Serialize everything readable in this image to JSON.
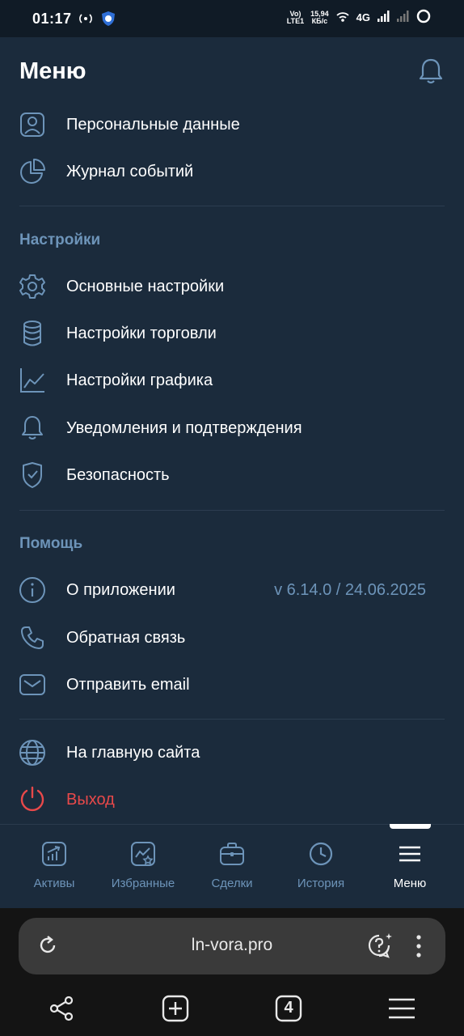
{
  "status_bar": {
    "time": "01:17",
    "volte_line1": "Vo)",
    "volte_line2": "LTE1",
    "speed_line1": "15,94",
    "speed_line2": "КБ/с",
    "network": "4G"
  },
  "header": {
    "title": "Меню",
    "bell_icon": "bell-icon"
  },
  "account": {
    "items": [
      {
        "label": "Персональные данные",
        "icon": "user-portrait-icon"
      },
      {
        "label": "Журнал событий",
        "icon": "pie-chart-icon"
      }
    ]
  },
  "settings": {
    "title": "Настройки",
    "items": [
      {
        "label": "Основные настройки",
        "icon": "gear-icon"
      },
      {
        "label": "Настройки торговли",
        "icon": "coin-stack-icon"
      },
      {
        "label": "Настройки графика",
        "icon": "line-chart-icon"
      },
      {
        "label": "Уведомления и подтверждения",
        "icon": "bell-icon"
      },
      {
        "label": "Безопасность",
        "icon": "shield-check-icon"
      }
    ]
  },
  "help": {
    "title": "Помощь",
    "items": [
      {
        "label": "О приложении",
        "value": "v 6.14.0 / 24.06.2025",
        "icon": "info-icon"
      },
      {
        "label": "Обратная связь",
        "icon": "phone-icon"
      },
      {
        "label": "Отправить email",
        "icon": "mail-icon"
      }
    ]
  },
  "misc": {
    "items": [
      {
        "label": "На главную сайта",
        "icon": "globe-icon"
      },
      {
        "label": "Выход",
        "icon": "power-icon"
      }
    ]
  },
  "tabbar": {
    "active": "Меню",
    "tabs": [
      {
        "label": "Активы",
        "icon": "assets-chart-icon"
      },
      {
        "label": "Избранные",
        "icon": "favorites-chart-icon"
      },
      {
        "label": "Сделки",
        "icon": "briefcase-icon"
      },
      {
        "label": "История",
        "icon": "clock-icon"
      },
      {
        "label": "Меню",
        "icon": "hamburger-icon"
      }
    ]
  },
  "browser": {
    "url": "ln-vora.pro",
    "tab_count": "4"
  },
  "colors": {
    "background": "#1b2b3c",
    "accent": "#6d94b9",
    "danger": "#e8494a",
    "text": "#ffffff"
  }
}
